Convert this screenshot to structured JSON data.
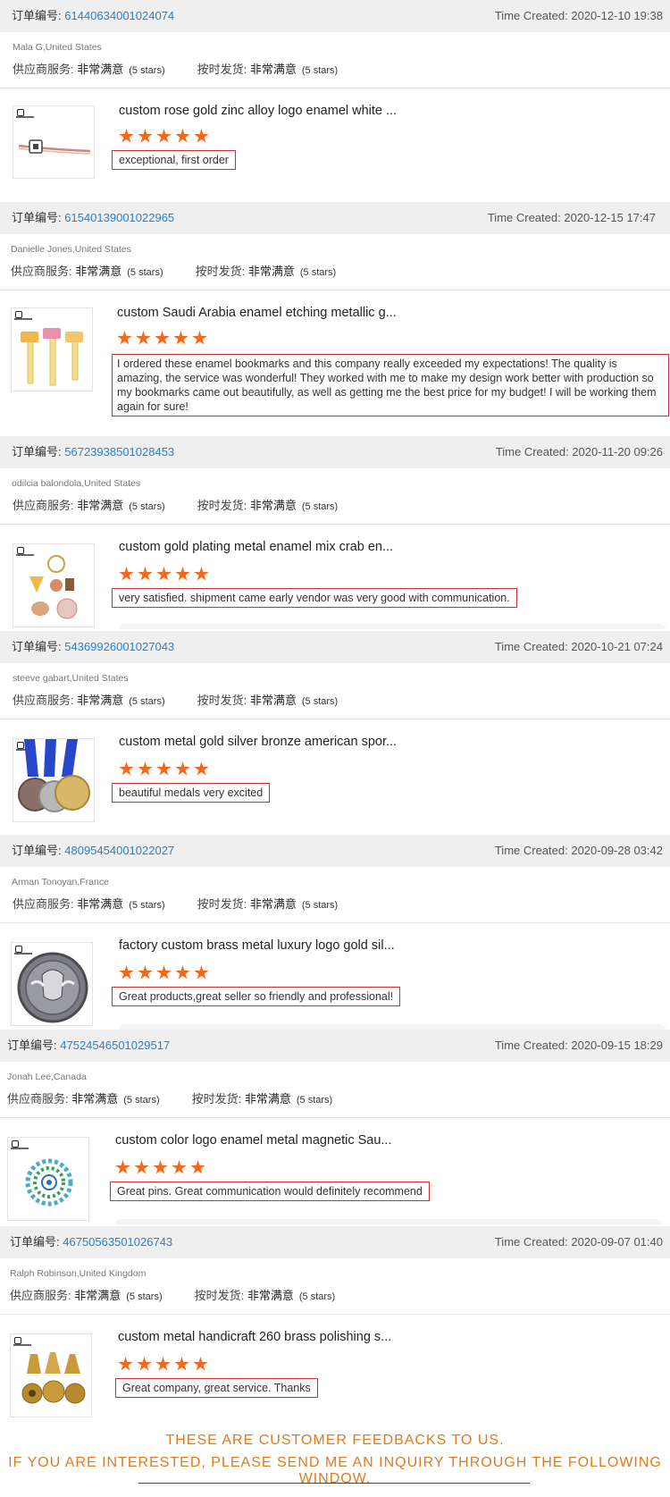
{
  "labels": {
    "order_no": "订单编号:",
    "supplier_service": "供应商服务:",
    "on_time_delivery": "按时发货:",
    "rating_value": "非常满意",
    "rating_stars": "(5 stars)",
    "time_created_prefix": "Time Created: "
  },
  "colors": {
    "accent_link": "#2a7fc6",
    "star": "#f3681a",
    "review_border": "#c9302c",
    "footer_text": "#e07a1f"
  },
  "orders": [
    {
      "order_id": "61440634001024074",
      "time_created": "2020-12-10 19:38",
      "buyer": "Mala G,United States",
      "product_title": "custom rose gold zinc alloy logo enamel white ...",
      "stars": 5,
      "review": "exceptional, first order",
      "thumb_icon": "bookmark-clip-icon"
    },
    {
      "order_id": "61540139001022965",
      "time_created": "2020-12-15 17:47",
      "buyer": "Danielle Jones,United States",
      "product_title": "custom Saudi Arabia enamel etching metallic g...",
      "stars": 5,
      "review": "I ordered these enamel bookmarks and this company really exceeded my expectations! The quality is amazing, the service was wonderful! They worked with me to make my design work better with production so my bookmarks came out beautifully, as well as getting me the best price for my budget! I will be working them again for sure!",
      "thumb_icon": "enamel-bookmarks-icon"
    },
    {
      "order_id": "56723938501028453",
      "time_created": "2020-11-20 09:26",
      "buyer": "odilcia balondola,United States",
      "product_title": "custom gold plating metal enamel mix crab en...",
      "stars": 5,
      "review": "very satisfied. shipment came early vendor was very good with communication.",
      "thumb_icon": "keychain-charms-icon"
    },
    {
      "order_id": "54369926001027043",
      "time_created": "2020-10-21 07:24",
      "buyer": "steeve gabart,United States",
      "product_title": "custom metal gold silver bronze american spor...",
      "stars": 5,
      "review": "beautiful medals very excited",
      "thumb_icon": "medals-icon"
    },
    {
      "order_id": "48095454001022027",
      "time_created": "2020-09-28 03:42",
      "buyer": "Arman Tonoyan,France",
      "product_title": "factory custom brass metal luxury logo gold sil...",
      "stars": 5,
      "review": "Great products,great seller so friendly and professional!",
      "thumb_icon": "spartan-coin-icon"
    },
    {
      "order_id": "47524546501029517",
      "time_created": "2020-09-15 18:29",
      "buyer": "Jonah Lee,Canada",
      "product_title": "custom color logo enamel metal magnetic Sau...",
      "stars": 5,
      "review": "Great pins. Great communication would definitely recommend",
      "thumb_icon": "star-pin-icon"
    },
    {
      "order_id": "46750563501026743",
      "time_created": "2020-09-07 01:40",
      "buyer": "Ralph Robinson,United Kingdom",
      "product_title": "custom metal handicraft 260 brass polishing s...",
      "stars": 5,
      "review": "Great company, great service. Thanks",
      "thumb_icon": "brass-parts-icon"
    }
  ],
  "footer": {
    "line1": "THESE ARE CUSTOMER FEEDBACKS TO US.",
    "line2": "IF YOU ARE INTERESTED, PLEASE SEND ME AN INQUIRY THROUGH THE FOLLOWING WINDOW."
  }
}
